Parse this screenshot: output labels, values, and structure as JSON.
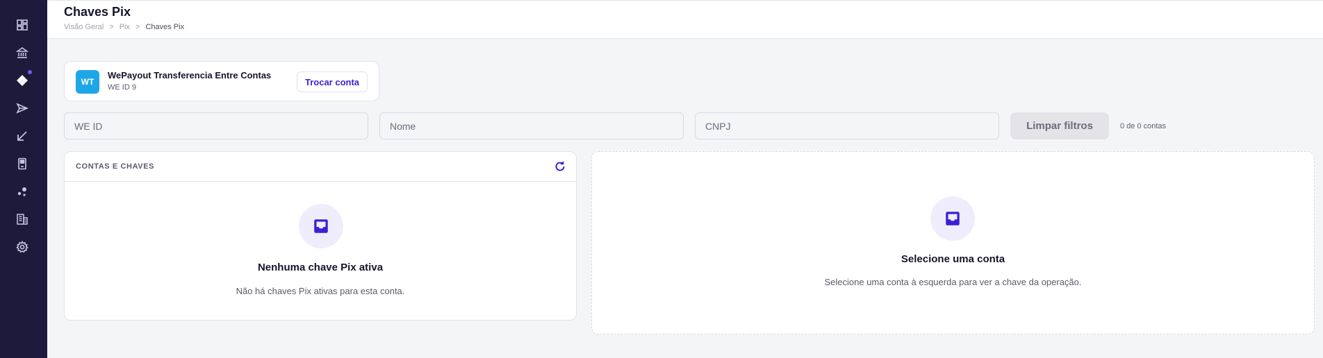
{
  "header": {
    "title": "Chaves Pix",
    "breadcrumb": [
      "Visão Geral",
      "Pix",
      "Chaves Pix"
    ],
    "separator": ">"
  },
  "sidebar": {
    "items": [
      {
        "icon": "dashboard-icon"
      },
      {
        "icon": "bank-icon"
      },
      {
        "icon": "pix-icon",
        "notification": true
      },
      {
        "icon": "send-icon"
      },
      {
        "icon": "receive-arrow-icon"
      },
      {
        "icon": "device-icon"
      },
      {
        "icon": "dots-icon"
      },
      {
        "icon": "building-icon"
      },
      {
        "icon": "gear-icon"
      }
    ]
  },
  "account": {
    "initials": "WT",
    "name": "WePayout Transferencia Entre Contas",
    "id_label": "WE ID 9",
    "switch_label": "Trocar conta"
  },
  "filters": {
    "we_id_placeholder": "WE ID",
    "name_placeholder": "Nome",
    "cnpj_placeholder": "CNPJ",
    "clear_label": "Limpar filtros",
    "count_text": "0 de 0 contas"
  },
  "left_panel": {
    "header": "CONTAS E CHAVES",
    "empty_title": "Nenhuma chave Pix ativa",
    "empty_desc": "Não há chaves Pix ativas para esta conta."
  },
  "right_panel": {
    "empty_title": "Selecione uma conta",
    "empty_desc": "Selecione uma conta à esquerda para ver a chave da operação."
  },
  "colors": {
    "sidebar": "#1e1a3c",
    "accent": "#3b1fd4",
    "avatar": "#1ea7e8",
    "icon_bg": "#efedfb"
  }
}
